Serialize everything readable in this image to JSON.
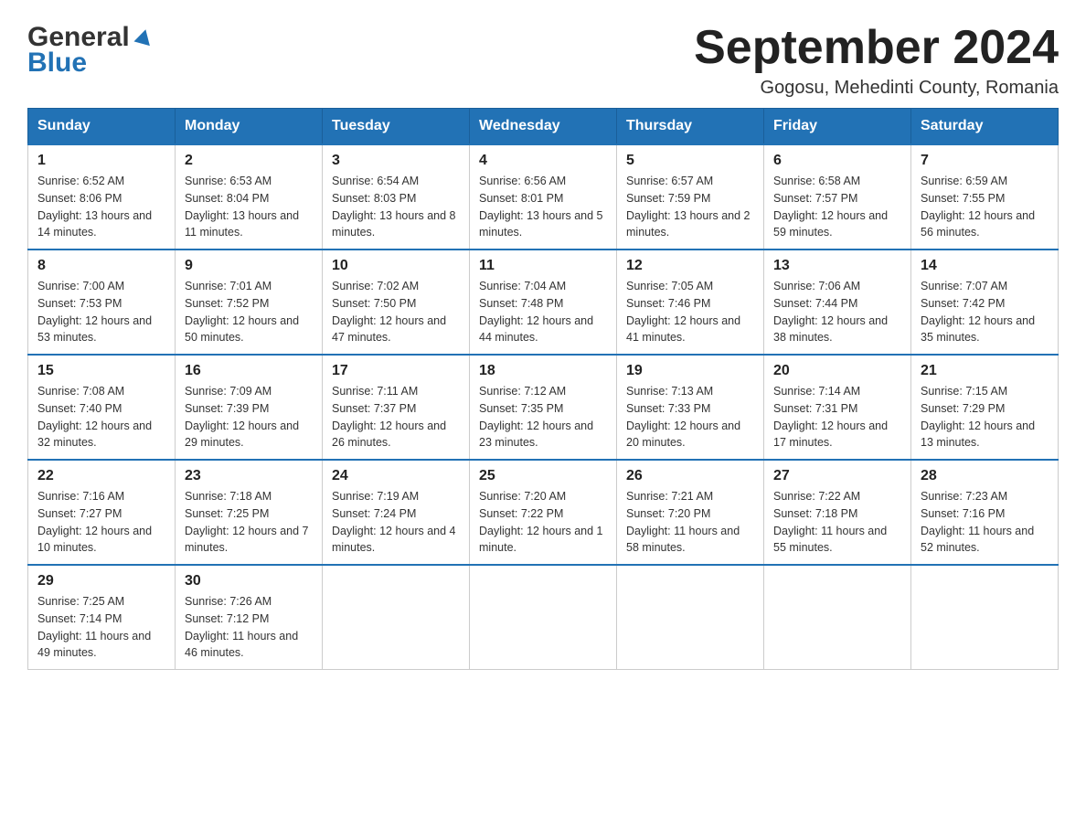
{
  "header": {
    "logo_line1": "General",
    "logo_line2": "Blue",
    "title": "September 2024",
    "subtitle": "Gogosu, Mehedinti County, Romania"
  },
  "calendar": {
    "days_of_week": [
      "Sunday",
      "Monday",
      "Tuesday",
      "Wednesday",
      "Thursday",
      "Friday",
      "Saturday"
    ],
    "weeks": [
      [
        {
          "day": "1",
          "sunrise": "6:52 AM",
          "sunset": "8:06 PM",
          "daylight": "13 hours and 14 minutes."
        },
        {
          "day": "2",
          "sunrise": "6:53 AM",
          "sunset": "8:04 PM",
          "daylight": "13 hours and 11 minutes."
        },
        {
          "day": "3",
          "sunrise": "6:54 AM",
          "sunset": "8:03 PM",
          "daylight": "13 hours and 8 minutes."
        },
        {
          "day": "4",
          "sunrise": "6:56 AM",
          "sunset": "8:01 PM",
          "daylight": "13 hours and 5 minutes."
        },
        {
          "day": "5",
          "sunrise": "6:57 AM",
          "sunset": "7:59 PM",
          "daylight": "13 hours and 2 minutes."
        },
        {
          "day": "6",
          "sunrise": "6:58 AM",
          "sunset": "7:57 PM",
          "daylight": "12 hours and 59 minutes."
        },
        {
          "day": "7",
          "sunrise": "6:59 AM",
          "sunset": "7:55 PM",
          "daylight": "12 hours and 56 minutes."
        }
      ],
      [
        {
          "day": "8",
          "sunrise": "7:00 AM",
          "sunset": "7:53 PM",
          "daylight": "12 hours and 53 minutes."
        },
        {
          "day": "9",
          "sunrise": "7:01 AM",
          "sunset": "7:52 PM",
          "daylight": "12 hours and 50 minutes."
        },
        {
          "day": "10",
          "sunrise": "7:02 AM",
          "sunset": "7:50 PM",
          "daylight": "12 hours and 47 minutes."
        },
        {
          "day": "11",
          "sunrise": "7:04 AM",
          "sunset": "7:48 PM",
          "daylight": "12 hours and 44 minutes."
        },
        {
          "day": "12",
          "sunrise": "7:05 AM",
          "sunset": "7:46 PM",
          "daylight": "12 hours and 41 minutes."
        },
        {
          "day": "13",
          "sunrise": "7:06 AM",
          "sunset": "7:44 PM",
          "daylight": "12 hours and 38 minutes."
        },
        {
          "day": "14",
          "sunrise": "7:07 AM",
          "sunset": "7:42 PM",
          "daylight": "12 hours and 35 minutes."
        }
      ],
      [
        {
          "day": "15",
          "sunrise": "7:08 AM",
          "sunset": "7:40 PM",
          "daylight": "12 hours and 32 minutes."
        },
        {
          "day": "16",
          "sunrise": "7:09 AM",
          "sunset": "7:39 PM",
          "daylight": "12 hours and 29 minutes."
        },
        {
          "day": "17",
          "sunrise": "7:11 AM",
          "sunset": "7:37 PM",
          "daylight": "12 hours and 26 minutes."
        },
        {
          "day": "18",
          "sunrise": "7:12 AM",
          "sunset": "7:35 PM",
          "daylight": "12 hours and 23 minutes."
        },
        {
          "day": "19",
          "sunrise": "7:13 AM",
          "sunset": "7:33 PM",
          "daylight": "12 hours and 20 minutes."
        },
        {
          "day": "20",
          "sunrise": "7:14 AM",
          "sunset": "7:31 PM",
          "daylight": "12 hours and 17 minutes."
        },
        {
          "day": "21",
          "sunrise": "7:15 AM",
          "sunset": "7:29 PM",
          "daylight": "12 hours and 13 minutes."
        }
      ],
      [
        {
          "day": "22",
          "sunrise": "7:16 AM",
          "sunset": "7:27 PM",
          "daylight": "12 hours and 10 minutes."
        },
        {
          "day": "23",
          "sunrise": "7:18 AM",
          "sunset": "7:25 PM",
          "daylight": "12 hours and 7 minutes."
        },
        {
          "day": "24",
          "sunrise": "7:19 AM",
          "sunset": "7:24 PM",
          "daylight": "12 hours and 4 minutes."
        },
        {
          "day": "25",
          "sunrise": "7:20 AM",
          "sunset": "7:22 PM",
          "daylight": "12 hours and 1 minute."
        },
        {
          "day": "26",
          "sunrise": "7:21 AM",
          "sunset": "7:20 PM",
          "daylight": "11 hours and 58 minutes."
        },
        {
          "day": "27",
          "sunrise": "7:22 AM",
          "sunset": "7:18 PM",
          "daylight": "11 hours and 55 minutes."
        },
        {
          "day": "28",
          "sunrise": "7:23 AM",
          "sunset": "7:16 PM",
          "daylight": "11 hours and 52 minutes."
        }
      ],
      [
        {
          "day": "29",
          "sunrise": "7:25 AM",
          "sunset": "7:14 PM",
          "daylight": "11 hours and 49 minutes."
        },
        {
          "day": "30",
          "sunrise": "7:26 AM",
          "sunset": "7:12 PM",
          "daylight": "11 hours and 46 minutes."
        },
        null,
        null,
        null,
        null,
        null
      ]
    ]
  }
}
